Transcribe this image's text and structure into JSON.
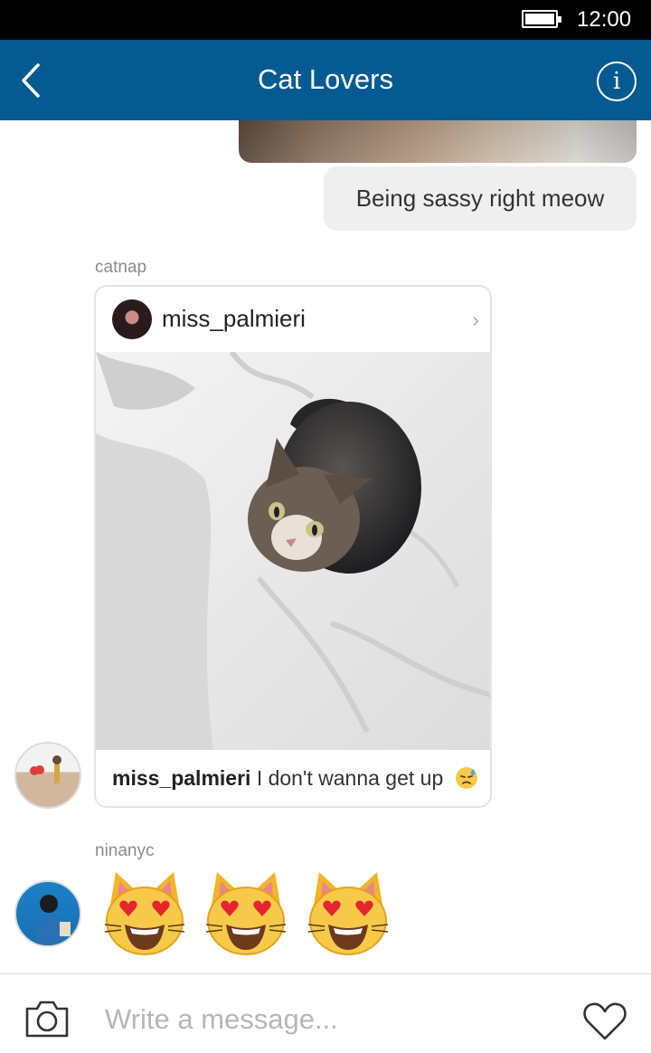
{
  "status_bar": {
    "time": "12:00"
  },
  "header": {
    "title": "Cat Lovers"
  },
  "messages": {
    "outgoing_text": "Being sassy right meow"
  },
  "shared_post": {
    "sender": "catnap",
    "username": "miss_palmieri",
    "caption_user": "miss_palmieri",
    "caption_text": "I don't wanna get up",
    "caption_emoji": "downcast-sweat-face"
  },
  "emoji_message": {
    "sender": "ninanyc",
    "emojis": [
      "smiling-cat-heart-eyes",
      "smiling-cat-heart-eyes",
      "smiling-cat-heart-eyes"
    ]
  },
  "composer": {
    "placeholder": "Write a message..."
  },
  "colors": {
    "header": "#045a91",
    "bubble": "#efefef"
  }
}
